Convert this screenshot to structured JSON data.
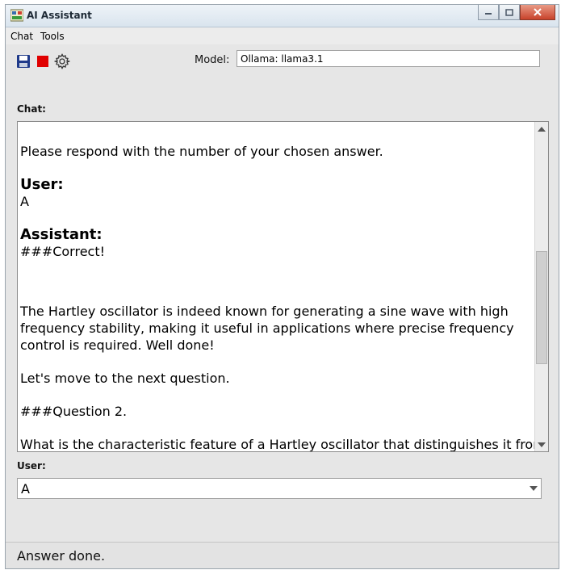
{
  "window": {
    "title": "AI Assistant"
  },
  "menu": {
    "items": [
      "Chat",
      "Tools"
    ]
  },
  "toolbar": {
    "save_icon": "save-icon",
    "stop_icon": "stop-icon",
    "settings_icon": "gear-icon",
    "model_label": "Model:",
    "model_value": "Ollama: llama3.1"
  },
  "chat": {
    "label": "Chat:",
    "messages": {
      "intro": "Please respond with the number of your chosen answer.",
      "user_role": "User:",
      "user_text": "A",
      "assistant_role": "Assistant:",
      "assistant_heading": "###Correct!",
      "para1": "The Hartley oscillator is indeed known for generating a sine wave with high frequency stability, making it useful in applications where precise frequency control is required. Well done!",
      "para2": "Let's move to the next question.",
      "question_heading": "###Question 2.",
      "question_text": "What is the characteristic feature of a Hartley oscillator that distinguishes it from"
    }
  },
  "input": {
    "label": "User:",
    "value": "A"
  },
  "status": {
    "text": "Answer done."
  },
  "colors": {
    "stop_red": "#e00000",
    "save_blue": "#1f3a8a",
    "close_red": "#c8432b"
  }
}
